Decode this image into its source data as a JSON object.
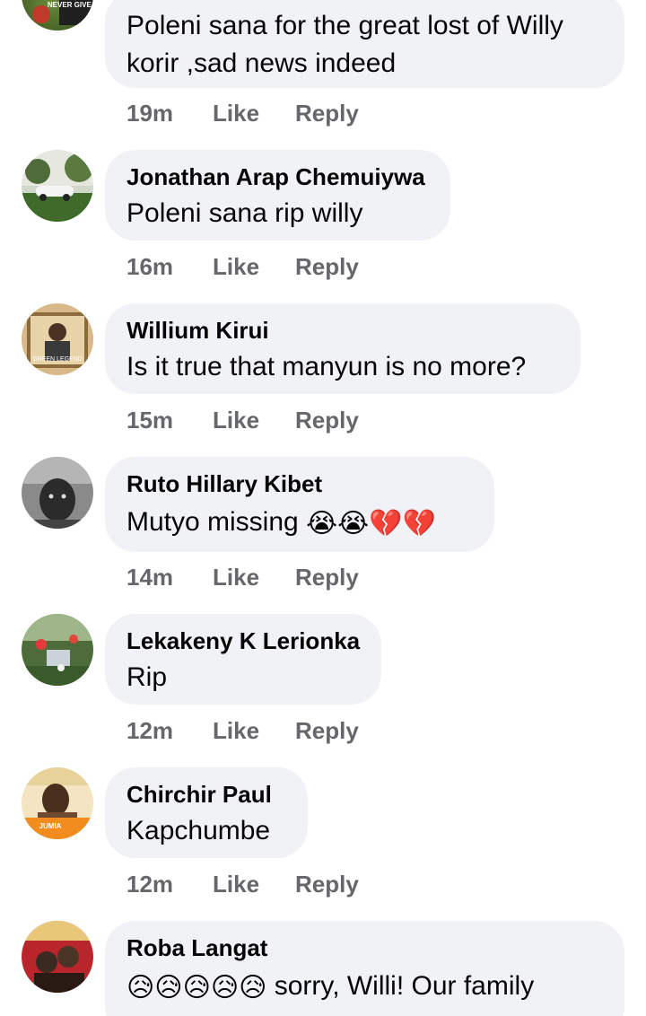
{
  "comments": [
    {
      "author": "",
      "text_lines": [
        "Poleni sana for the great lost of Willy",
        "korir ,sad news  indeed"
      ],
      "time": "19m",
      "like": "Like",
      "reply": "Reply",
      "avatar_text": "NEVER GIVE UP"
    },
    {
      "author": "Jonathan Arap Chemuiywa",
      "text_lines": [
        "Poleni sana rip willy"
      ],
      "time": "16m",
      "like": "Like",
      "reply": "Reply"
    },
    {
      "author": "Willium Kirui",
      "text_lines": [
        "Is it true that manyun is no more?"
      ],
      "time": "15m",
      "like": "Like",
      "reply": "Reply",
      "avatar_text": "GREEN LEGEND"
    },
    {
      "author": "Ruto Hillary Kibet",
      "text_lines": [
        "Mutyo missing"
      ],
      "emojis": [
        "😭",
        "😭",
        "💔",
        "💔"
      ],
      "time": "14m",
      "like": "Like",
      "reply": "Reply"
    },
    {
      "author": "Lekakeny K Lerionka",
      "text_lines": [
        "Rip"
      ],
      "time": "12m",
      "like": "Like",
      "reply": "Reply"
    },
    {
      "author": "Chirchir Paul",
      "text_lines": [
        "Kapchumbe"
      ],
      "time": "12m",
      "like": "Like",
      "reply": "Reply",
      "avatar_text": "JUMIA"
    },
    {
      "author": "Roba Langat",
      "text_lines": [
        "sorry, Willi!  Our family"
      ],
      "emojis": [
        "😥",
        "😥",
        "😥",
        "😥",
        "😥"
      ],
      "time": "",
      "like": "",
      "reply": ""
    }
  ],
  "colors": {
    "bubble": "#f0f2f5",
    "meta": "#65676b",
    "text": "#050505"
  }
}
